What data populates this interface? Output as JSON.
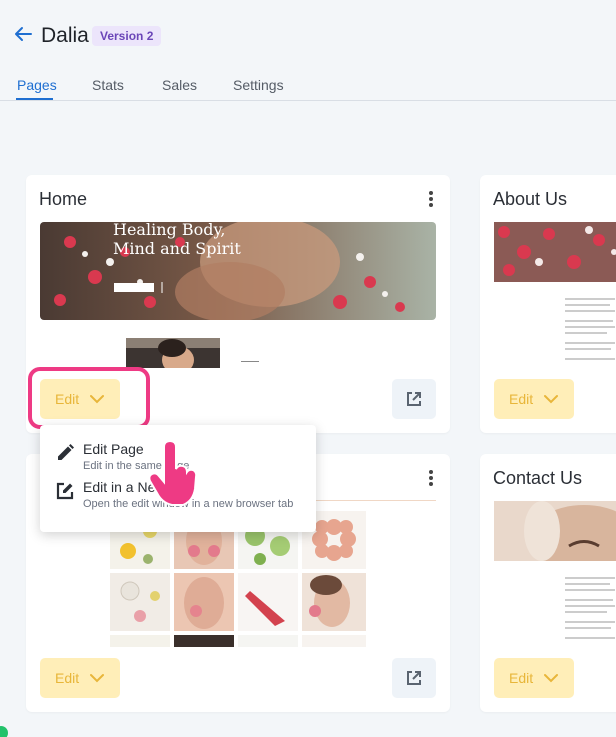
{
  "header": {
    "title": "Dalia",
    "version": "Version 2"
  },
  "tabs": [
    {
      "label": "Pages",
      "active": true
    },
    {
      "label": "Stats",
      "active": false
    },
    {
      "label": "Sales",
      "active": false
    },
    {
      "label": "Settings",
      "active": false
    }
  ],
  "cards": [
    {
      "title": "Home",
      "edit_label": "Edit",
      "hero_heading_line1": "Healing Body,",
      "hero_heading_line2": "Mind and Spirit"
    },
    {
      "title": "About Us",
      "edit_label": "Edit"
    },
    {
      "title": "",
      "edit_label": "Edit"
    },
    {
      "title": "Contact Us",
      "edit_label": "Edit"
    }
  ],
  "dropdown": {
    "items": [
      {
        "title": "Edit Page",
        "subtitle": "Edit in the same page",
        "icon": "pencil-icon"
      },
      {
        "title": "Edit in a New Tab",
        "subtitle": "Open the edit window in a new browser tab",
        "icon": "edit-external-icon"
      }
    ]
  },
  "colors": {
    "accent": "#1f6fd1",
    "badge_bg": "#ece5fb",
    "badge_text": "#6b46b8",
    "edit_bg": "#ffeeb8",
    "edit_text": "#e8b63a",
    "highlight": "#ee3a84",
    "cursor": "#ee3a84"
  }
}
